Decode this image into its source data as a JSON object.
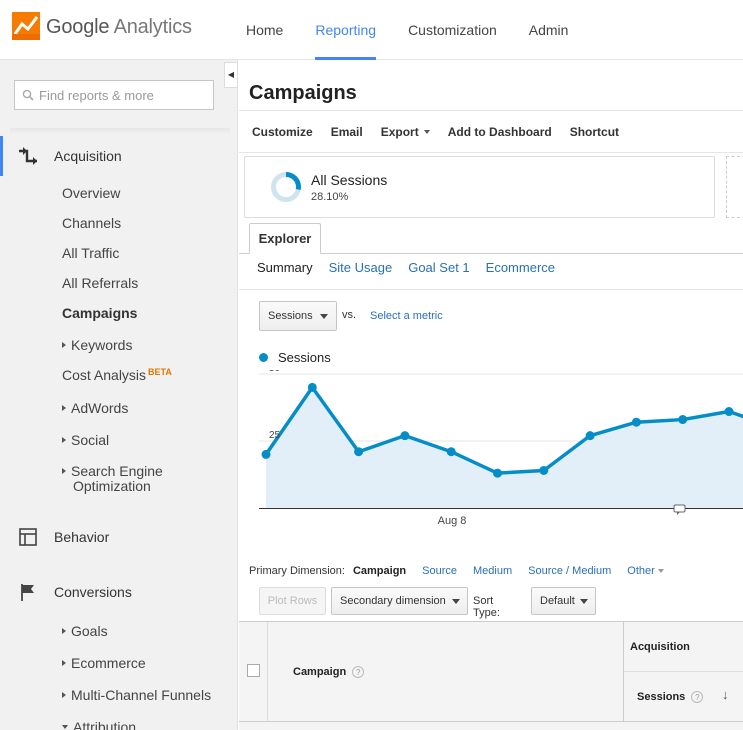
{
  "header": {
    "brand_google": "Google",
    "brand_analytics": "Analytics",
    "logo_icon": "google-analytics-logo",
    "nav": [
      {
        "label": "Home",
        "active": false
      },
      {
        "label": "Reporting",
        "active": true
      },
      {
        "label": "Customization",
        "active": false
      },
      {
        "label": "Admin",
        "active": false
      }
    ]
  },
  "sidebar": {
    "collapse_glyph": "◀",
    "search": {
      "placeholder": "Find reports & more",
      "value": ""
    },
    "sections": [
      {
        "label": "Acquisition",
        "icon": "acquisition-arrows-icon",
        "active": true
      },
      {
        "label": "Behavior",
        "icon": "behavior-layout-icon",
        "active": false
      },
      {
        "label": "Conversions",
        "icon": "conversions-flag-icon",
        "active": false
      }
    ],
    "acquisition_items": [
      {
        "label": "Overview"
      },
      {
        "label": "Channels"
      },
      {
        "label": "All Traffic"
      },
      {
        "label": "All Referrals"
      },
      {
        "label": "Campaigns"
      },
      {
        "label": "Keywords"
      },
      {
        "label": "Cost Analysis",
        "badge": "BETA"
      },
      {
        "label": "AdWords"
      },
      {
        "label": "Social"
      },
      {
        "label": "Search Engine"
      },
      {
        "label": "Optimization"
      }
    ],
    "conversions_items": [
      {
        "label": "Goals"
      },
      {
        "label": "Ecommerce"
      },
      {
        "label": "Multi-Channel Funnels"
      },
      {
        "label": "Attribution"
      }
    ]
  },
  "main": {
    "title": "Campaigns",
    "toolbar": {
      "customize": "Customize",
      "email": "Email",
      "export": "Export",
      "add_to_dashboard": "Add to Dashboard",
      "shortcut": "Shortcut"
    },
    "segment": {
      "name": "All Sessions",
      "percent": "28.10%",
      "ring_fraction": 0.281,
      "ring_color": "#058dc7"
    },
    "explorer_tab": "Explorer",
    "subtabs": [
      "Summary",
      "Site Usage",
      "Goal Set 1",
      "Ecommerce"
    ],
    "metric_select": "Sessions",
    "vs": "vs.",
    "select_metric": "Select a metric",
    "legend_label": "Sessions",
    "primary_dimension": {
      "label": "Primary Dimension:",
      "value": "Campaign",
      "links": [
        "Source",
        "Medium",
        "Source / Medium",
        "Other"
      ]
    },
    "controls": {
      "plot_rows": "Plot Rows",
      "secondary_dimension": "Secondary dimension",
      "sort_type_label": "Sort Type:",
      "sort_type_value": "Default"
    },
    "table": {
      "campaign_header": "Campaign",
      "group_header": "Acquisition",
      "sessions_header": "Sessions",
      "help_glyph": "?",
      "sort_glyph": "↓"
    }
  },
  "chart_data": {
    "type": "area",
    "series": [
      {
        "name": "Sessions",
        "color": "#058dc7",
        "values": [
          20,
          45,
          21,
          27,
          21,
          13,
          14,
          27,
          32,
          33,
          36,
          30
        ]
      }
    ],
    "x_tick_labels": [
      "Aug 8"
    ],
    "y_tick_labels": [
      "50",
      "25"
    ],
    "ylim": [
      0,
      50
    ],
    "grid": true,
    "annotation_icon": "annotation-speech-icon"
  }
}
